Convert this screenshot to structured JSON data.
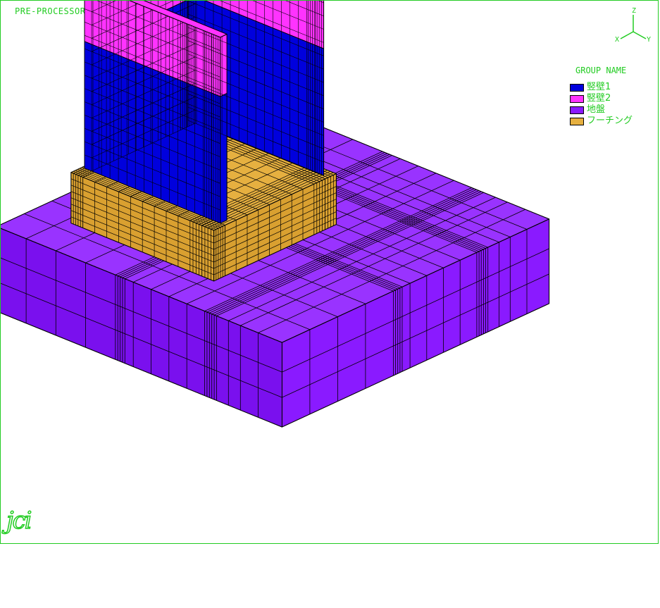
{
  "app": {
    "title": "PRE-PROCESSOR   FOR  JCMAC3"
  },
  "axis_triad": {
    "z": "Z",
    "x": "X",
    "y": "Y"
  },
  "legend": {
    "title": "GROUP NAME",
    "items": [
      {
        "label": "竪壁1",
        "color": "#0000dd"
      },
      {
        "label": "竪壁2",
        "color": "#ff33ff"
      },
      {
        "label": "地盤",
        "color": "#8a1aff"
      },
      {
        "label": "フーチング",
        "color": "#e6b040"
      }
    ]
  },
  "logo": {
    "text": "jci"
  },
  "colors": {
    "frame": "#22cc22",
    "mesh_line": "#000000",
    "ground_top": "#9933ff",
    "ground_front": "#8a1aff",
    "ground_side": "#7a10ee",
    "footing_top": "#e6b040",
    "footing_side": "#d9a030",
    "wall1": "#0000dd",
    "wall2": "#ff33ff"
  }
}
